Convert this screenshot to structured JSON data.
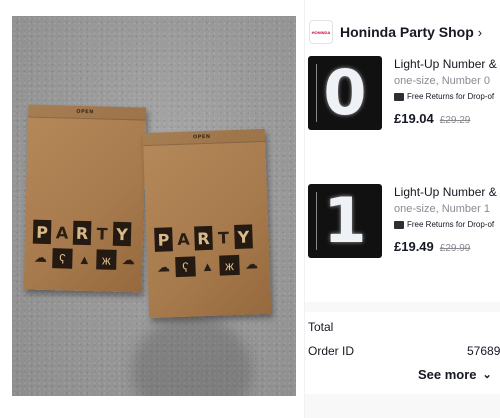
{
  "photo": {
    "box_left": {
      "open_label": "OPEN",
      "word": [
        "P",
        "A",
        "R",
        "T",
        "Y"
      ]
    },
    "box_right": {
      "open_label": "OPEN",
      "word": [
        "P",
        "A",
        "R",
        "T",
        "Y"
      ]
    }
  },
  "shop": {
    "logo_text": "HONINDA",
    "name": "Honinda Party Shop",
    "chevron": "›"
  },
  "items": [
    {
      "title": "Light-Up Number & L",
      "variant": "one-size, Number 0",
      "returns": "Free Returns for Drop-of",
      "price": "£19.04",
      "original_price": "£29.29",
      "digit": "0"
    },
    {
      "title": "Light-Up Number & L",
      "variant": "one-size, Number 1",
      "returns": "Free Returns for Drop-of",
      "price": "£19.49",
      "original_price": "£29.99",
      "digit": "1"
    }
  ],
  "order": {
    "total_label": "Total",
    "order_id_label": "Order ID",
    "order_id_value": "57689",
    "see_more_label": "See more",
    "see_more_chevron": "⌄"
  },
  "colors": {
    "text": "#161823",
    "muted": "#8a8b91",
    "cardboard": "#a67a4c"
  }
}
